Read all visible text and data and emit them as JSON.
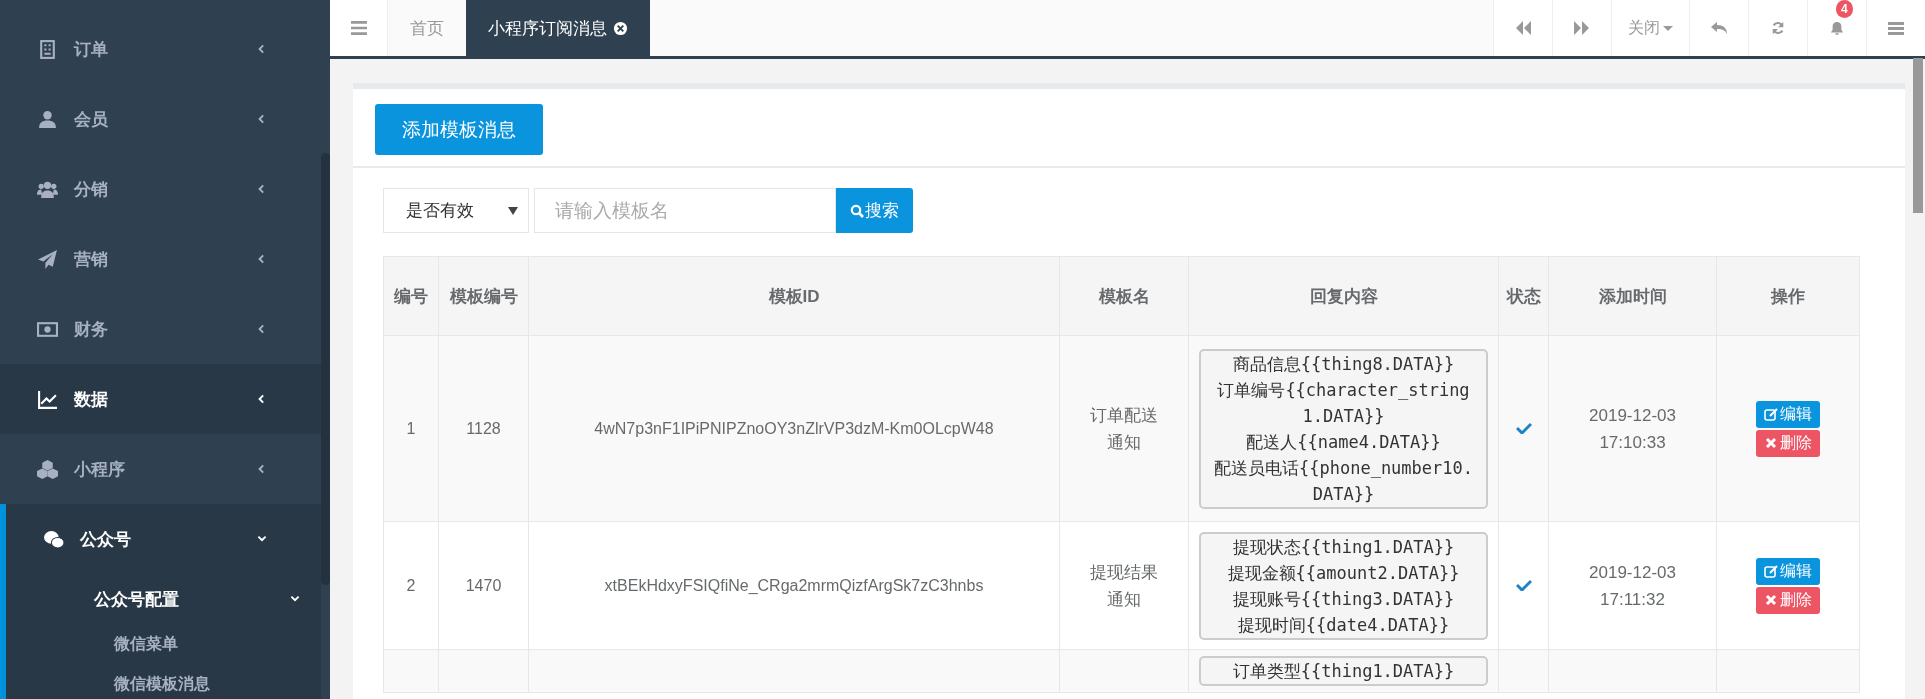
{
  "sidebar": {
    "items": [
      {
        "label": "订单",
        "selected": false,
        "expanded": false
      },
      {
        "label": "会员",
        "selected": false,
        "expanded": false
      },
      {
        "label": "分销",
        "selected": false,
        "expanded": false
      },
      {
        "label": "营销",
        "selected": false,
        "expanded": false
      },
      {
        "label": "财务",
        "selected": false,
        "expanded": false
      },
      {
        "label": "数据",
        "selected": true,
        "expanded": false
      },
      {
        "label": "小程序",
        "selected": false,
        "expanded": false
      },
      {
        "label": "公众号",
        "selected": true,
        "expanded": true,
        "children": [
          {
            "label": "公众号配置",
            "expanded": true,
            "children": [
              {
                "label": "微信菜单"
              },
              {
                "label": "微信模板消息"
              }
            ]
          }
        ]
      }
    ]
  },
  "tabs": [
    {
      "label": "首页",
      "selected": false
    },
    {
      "label": "小程序订阅消息",
      "selected": true
    }
  ],
  "toolbar": {
    "close_menu": "关闭",
    "notification_count": "4"
  },
  "add_button": "添加模板消息",
  "filter": {
    "status_select": "是否有效",
    "placeholder": "请输入模板名",
    "search_button": "搜索"
  },
  "table": {
    "columns": [
      "编号",
      "模板编号",
      "模板ID",
      "模板名",
      "回复内容",
      "状态",
      "添加时间",
      "操作"
    ],
    "rows": [
      {
        "no": "1",
        "template_no": "1128",
        "template_id": "4wN7p3nF1IPiPNIPZnoOY3nZlrVP3dzM-Km0OLcpW48",
        "name": "订单配送通知",
        "reply": [
          "商品信息{{thing8.DATA}}",
          "订单编号{{character_string1.DATA}}",
          "配送人{{name4.DATA}}",
          "配送员电话{{phone_number10.DATA}}"
        ],
        "valid": true,
        "time": "2019-12-03 17:10:33",
        "actions": [
          {
            "kind": "edit",
            "label": "编辑"
          },
          {
            "kind": "delete",
            "label": "删除"
          }
        ]
      },
      {
        "no": "2",
        "template_no": "1470",
        "template_id": "xtBEkHdxyFSIQfiNe_CRga2mrmQizfArgSk7zC3hnbs",
        "name": "提现结果通知",
        "reply": [
          "提现状态{{thing1.DATA}}",
          "提现金额{{amount2.DATA}}",
          "提现账号{{thing3.DATA}}",
          "提现时间{{date4.DATA}}"
        ],
        "valid": true,
        "time": "2019-12-03 17:11:32",
        "actions": [
          {
            "kind": "edit",
            "label": "编辑"
          },
          {
            "kind": "delete",
            "label": "删除"
          }
        ]
      },
      {
        "reply": [
          "订单类型{{thing1.DATA}}"
        ]
      }
    ]
  }
}
